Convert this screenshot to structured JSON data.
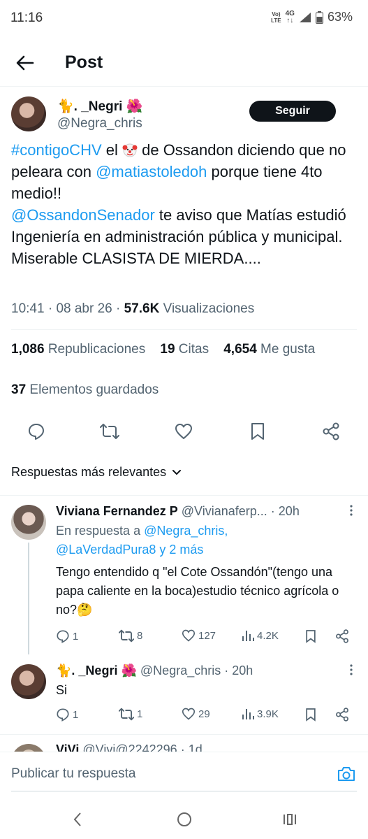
{
  "status_bar": {
    "time": "11:16",
    "volte_top": "Vo)",
    "volte_mid": "LTE",
    "network": "4G",
    "battery": "63%"
  },
  "header": {
    "title": "Post"
  },
  "tweet": {
    "author": {
      "name_icon": "🐈",
      "name": ". _Negri",
      "name_flower": "🌺",
      "handle": "@Negra_chris"
    },
    "follow_label": "Seguir",
    "text": {
      "hashtag": "#contigoCHV",
      "p1a": " el ",
      "p1b": " de Ossandon diciendo que no peleara con ",
      "mention1": "@matiastoledoh",
      "p2": " porque tiene 4to medio!!",
      "mention2": "@OssandonSenador",
      "p3": " te aviso que Matías estudió Ingeniería en administración pública y municipal.",
      "p4": "Miserable CLASISTA DE MIERDA...."
    },
    "meta": {
      "time": "10:41",
      "sep1": "·",
      "date": "08 abr 26",
      "sep2": "·",
      "views": "57.6K",
      "views_label": "Visualizaciones"
    },
    "stats": {
      "reposts": "1,086",
      "reposts_label": "Republicaciones",
      "quotes": "19",
      "quotes_label": "Citas",
      "likes": "4,654",
      "likes_label": "Me gusta",
      "bookmarks": "37",
      "bookmarks_label": "Elementos guardados"
    }
  },
  "sort_label": "Respuestas más relevantes",
  "replies": [
    {
      "name": "Viviana Fernandez P",
      "handle": "@Vivianaferp...",
      "time": "· 20h",
      "replying_prefix": "En respuesta a ",
      "replying_to1": "@Negra_chris,",
      "replying_to2": "@LaVerdadPura8 y 2 más",
      "text": "Tengo entendido q \"el Cote Ossandón\"(tengo una papa caliente en la boca)estudio técnico agrícola o no?🤔",
      "replies": "1",
      "reposts": "8",
      "likes": "127",
      "views": "4.2K"
    },
    {
      "name_icon": "🐈",
      "name": ". _Negri",
      "name_flower": "🌺",
      "handle": "@Negra_chris",
      "time": "· 20h",
      "text": "Si",
      "replies": "1",
      "reposts": "1",
      "likes": "29",
      "views": "3.9K"
    },
    {
      "name": "ViVi",
      "handle": "@Vivi@2242296",
      "time": "· 1d"
    }
  ],
  "compose": {
    "placeholder": "Publicar tu respuesta"
  },
  "colors": {
    "accent": "#1d9bf0",
    "text": "#0f1419",
    "muted": "#536471",
    "border": "#eff3f4"
  }
}
